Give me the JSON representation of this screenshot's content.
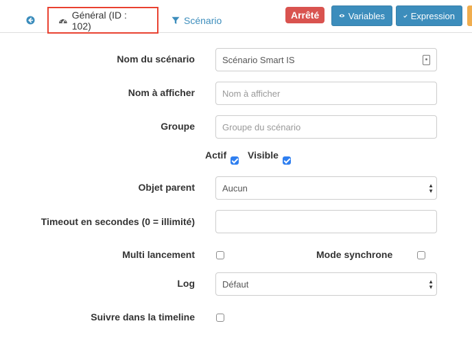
{
  "tabs": {
    "back_icon": "circle-arrow-left-icon",
    "general": {
      "icon": "dashboard-icon",
      "label": "Général (ID : 102)"
    },
    "scenario": {
      "icon": "filter-icon",
      "label": "Scénario"
    }
  },
  "toolbar": {
    "status_label": "Arrêté",
    "variables_icon": "eye-icon",
    "variables_label": "Variables",
    "expression_icon": "check-icon",
    "expression_label": "Expression"
  },
  "form": {
    "name_label": "Nom du scénario",
    "name_value": "Scénario Smart IS",
    "display_label": "Nom à afficher",
    "display_placeholder": "Nom à afficher",
    "group_label": "Groupe",
    "group_placeholder": "Groupe du scénario",
    "active_label": "Actif",
    "active_checked": true,
    "visible_label": "Visible",
    "visible_checked": true,
    "parent_label": "Objet parent",
    "parent_value": "Aucun",
    "timeout_label": "Timeout en secondes (0 = illimité)",
    "timeout_value": "",
    "multi_label": "Multi lancement",
    "multi_checked": false,
    "sync_label": "Mode synchrone",
    "sync_checked": false,
    "log_label": "Log",
    "log_value": "Défaut",
    "timeline_label": "Suivre dans la timeline",
    "timeline_checked": false
  },
  "colors": {
    "primary": "#3c8dbc",
    "danger": "#d9534f",
    "highlight": "#e8402f",
    "checkbox": "#2f7ff0"
  }
}
